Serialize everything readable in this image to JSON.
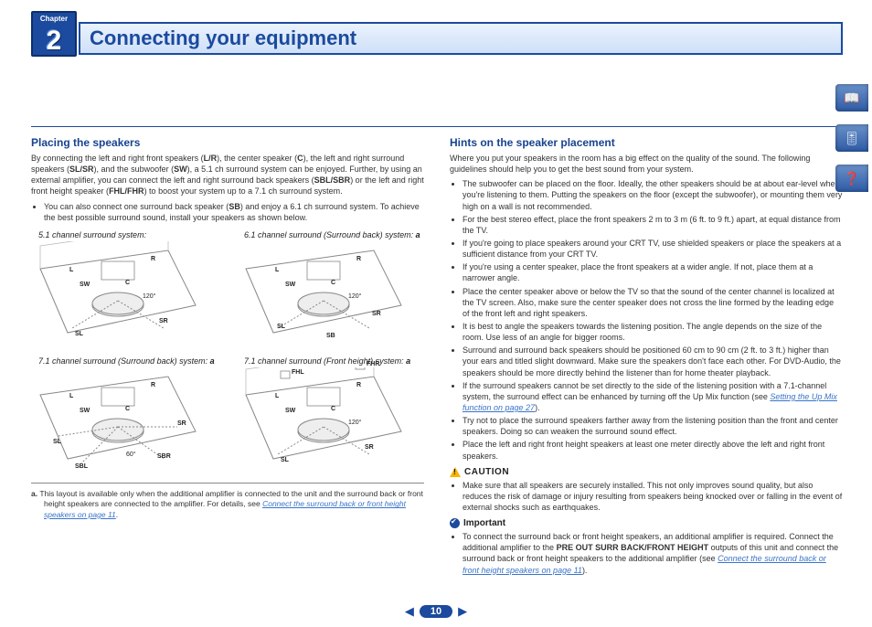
{
  "chapter": {
    "label": "Chapter",
    "number": "2"
  },
  "title": "Connecting your equipment",
  "page_number": "10",
  "left": {
    "heading": "Placing the speakers",
    "intro": {
      "pre": "By connecting the left and right front speakers (",
      "lr": "L/R",
      "a1": "), the center speaker (",
      "c": "C",
      "a2": "), the left and right surround speakers (",
      "slsr": "SL/SR",
      "a3": "), and the subwoofer (",
      "sw": "SW",
      "a4": "), a 5.1 ch surround system can be enjoyed. Further, by using an external amplifier, you can connect the left and right surround back speakers (",
      "sblsbr": "SBL/SBR",
      "a5": ") or the left and right front height speaker (",
      "fhlfhr": "FHL/FHR",
      "a6": ") to boost your system up to a 7.1 ch surround system."
    },
    "bullet1_pre": "You can also connect one surround back speaker (",
    "bullet1_sb": "SB",
    "bullet1_post": ") and enjoy a 6.1 ch surround system. To achieve the best possible surround sound, install your speakers as shown below.",
    "captions": [
      "5.1 channel surround system:",
      "6.1 channel surround (Surround back) system: ",
      "7.1 channel surround (Surround back) system: ",
      "7.1 channel surround (Front height) system: "
    ],
    "room_labels": {
      "L": "L",
      "R": "R",
      "C": "C",
      "SW": "SW",
      "SL": "SL",
      "SR": "SR",
      "SB": "SB",
      "SBL": "SBL",
      "SBR": "SBR",
      "FHL": "FHL",
      "FHR": "FHR",
      "ang120": "120°",
      "ang60": "60°"
    },
    "footnote_label": "a.",
    "footnote_text": "This layout is available only when the additional amplifier is connected to the unit and the surround back or front height speakers are connected to the amplifier. For details, see ",
    "footnote_link": "Connect the surround back or front height speakers on page 11",
    "footnote_after": "."
  },
  "right": {
    "heading": "Hints on the speaker placement",
    "intro": "Where you put your speakers in the room has a big effect on the quality of the sound. The following guidelines should help you to get the best sound from your system.",
    "bullets": [
      "The subwoofer can be placed on the floor. Ideally, the other speakers should be at about ear-level when you're listening to them. Putting the speakers on the floor (except the subwoofer), or mounting them very high on a wall is not recommended.",
      "For the best stereo effect, place the front speakers 2 m to 3 m (6 ft. to 9 ft.) apart, at equal distance from the TV.",
      "If you're going to place speakers around your CRT TV, use shielded speakers or place the speakers at a sufficient distance from your CRT TV.",
      "If you're using a center speaker, place the front speakers at a wider angle. If not, place them at a narrower angle.",
      "Place the center speaker above or below the TV so that the sound of the center channel is localized at the TV screen. Also, make sure the center speaker does not cross the line formed by the leading edge of the front left and right speakers.",
      "It is best to angle the speakers towards the listening position. The angle depends on the size of the room. Use less of an angle for bigger rooms.",
      "Surround and surround back speakers should be positioned 60 cm to 90 cm (2 ft. to 3 ft.) higher than your ears and titled slight downward. Make sure the speakers don't face each other. For DVD-Audio, the speakers should be more directly behind the listener than for home theater playback."
    ],
    "bullet_upmix_pre": "If the surround speakers cannot be set directly to the side of the listening position with a 7.1-channel system, the surround effect can be enhanced by turning off the Up Mix function (see ",
    "bullet_upmix_link": "Setting the Up Mix function on page 27",
    "bullet_upmix_post": ").",
    "bullets2": [
      "Try not to place the surround speakers farther away from the listening position than the front and center speakers. Doing so can weaken the surround sound effect.",
      "Place the left and right front height speakers at least one meter directly above the left and right front speakers."
    ],
    "caution_label": "CAUTION",
    "caution_bullet": "Make sure that all speakers are securely installed. This not only improves sound quality, but also reduces the risk of damage or injury resulting from speakers being knocked over or falling in the event of external shocks such as earthquakes.",
    "important_label": "Important",
    "important_pre": "To connect the surround back or front height speakers, an additional amplifier is required. Connect the additional amplifier to the ",
    "important_bold": "PRE OUT SURR BACK/FRONT HEIGHT",
    "important_mid": " outputs of this unit and connect the surround back or front height speakers to the additional amplifier (see ",
    "important_link": "Connect the surround back or front height speakers on page 11",
    "important_post": ")."
  },
  "side_tabs": [
    "book-icon",
    "receiver-icon",
    "help-icon"
  ]
}
